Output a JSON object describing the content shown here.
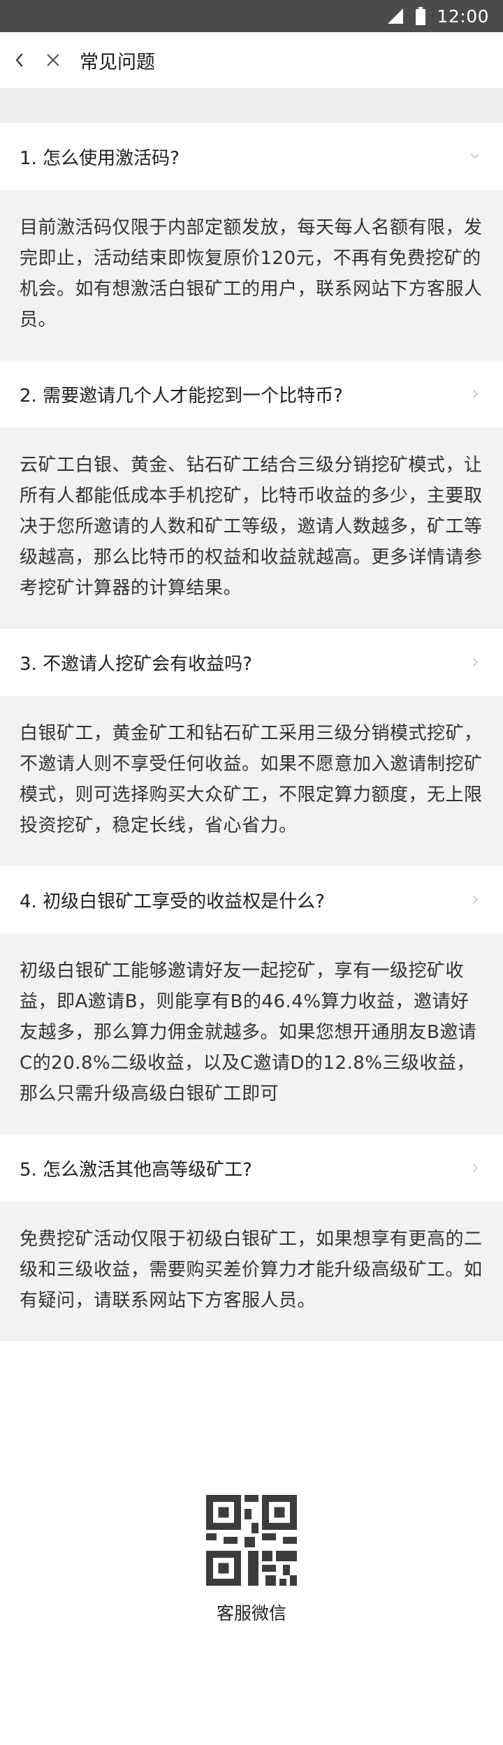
{
  "status_bar": {
    "time": "12:00",
    "icons": [
      "signal-icon",
      "battery-icon"
    ]
  },
  "nav": {
    "title": "常见问题",
    "icons": [
      "back-chevron-icon",
      "close-icon"
    ]
  },
  "faq": [
    {
      "question": "1. 怎么使用激活码?",
      "answer": "目前激活码仅限于内部定额发放，每天每人名额有限，发完即止，活动结束即恢复原价120元，不再有免费挖矿的机会。如有想激活白银矿工的用户，联系网站下方客服人员。",
      "chevron": "chevron-down-icon"
    },
    {
      "question": "2. 需要邀请几个人才能挖到一个比特币?",
      "answer": "云矿工白银、黄金、钻石矿工结合三级分销挖矿模式，让所有人都能低成本手机挖矿，比特币收益的多少，主要取决于您所邀请的人数和矿工等级，邀请人数越多，矿工等级越高，那么比特币的权益和收益就越高。更多详情请参考挖矿计算器的计算结果。",
      "chevron": "chevron-right-icon"
    },
    {
      "question": "3. 不邀请人挖矿会有收益吗?",
      "answer": "白银矿工，黄金矿工和钻石矿工采用三级分销模式挖矿，不邀请人则不享受任何收益。如果不愿意加入邀请制挖矿模式，则可选择购买大众矿工，不限定算力额度，无上限投资挖矿，稳定长线，省心省力。",
      "chevron": "chevron-right-icon"
    },
    {
      "question": "4. 初级白银矿工享受的收益权是什么?",
      "answer": "初级白银矿工能够邀请好友一起挖矿，享有一级挖矿收益，即A邀请B，则能享有B的46.4%算力收益，邀请好友越多，那么算力佣金就越多。如果您想开通朋友B邀请C的20.8%二级收益，以及C邀请D的12.8%三级收益，那么只需升级高级白银矿工即可",
      "chevron": "chevron-right-icon"
    },
    {
      "question": "5. 怎么激活其他高等级矿工?",
      "answer": "免费挖矿活动仅限于初级白银矿工，如果想享有更高的二级和三级收益，需要购买差价算力才能升级高级矿工。如有疑问，请联系网站下方客服人员。",
      "chevron": "chevron-right-icon"
    }
  ],
  "qr": {
    "caption": "客服微信",
    "icon": "qr-code-icon"
  }
}
